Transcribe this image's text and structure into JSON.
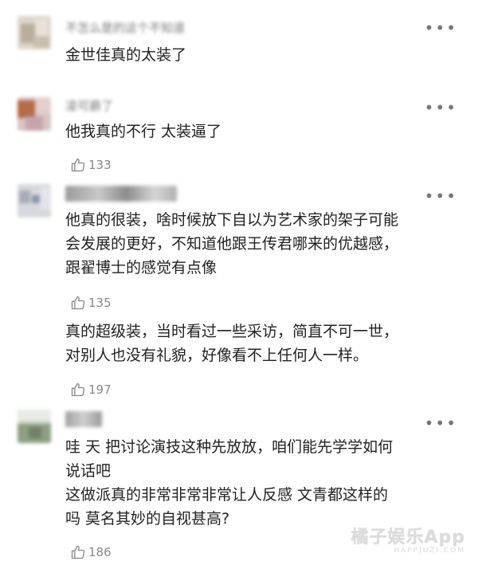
{
  "comments": [
    {
      "author": "不怎么是的这个不知道",
      "text_lines": [
        "金世佳真的太装了"
      ],
      "likes": null
    },
    {
      "author": "凌可爵了",
      "text_lines": [
        "他我真的不行 太装逼了"
      ],
      "likes": "133"
    },
    {
      "author": "",
      "text_lines": [
        "他真的很装，啥时候放下自以为艺术家的架子可能",
        "会发展的更好，不知道他跟王传君哪来的优越感，",
        "跟翟博士的感觉有点像"
      ],
      "likes": "135",
      "reply": {
        "text_lines": [
          "真的超级装，当时看过一些采访，简直不可一世，",
          "对别人也没有礼貌，好像看不上任何人一样。"
        ],
        "likes": "197"
      }
    },
    {
      "author": "",
      "text_lines": [
        "哇 天 把讨论演技这种先放放，咱们能先学学如何",
        "说话吧",
        "这做派真的非常非常非常让人反感 文青都这样的",
        "吗 莫名其妙的自视甚高?"
      ],
      "likes": "186"
    }
  ],
  "more_icon": "more-dots-icon",
  "like_icon": "thumbs-up-icon",
  "watermark": {
    "main": "橘子娱乐App",
    "sub": "HAPPJUZI.COM"
  }
}
